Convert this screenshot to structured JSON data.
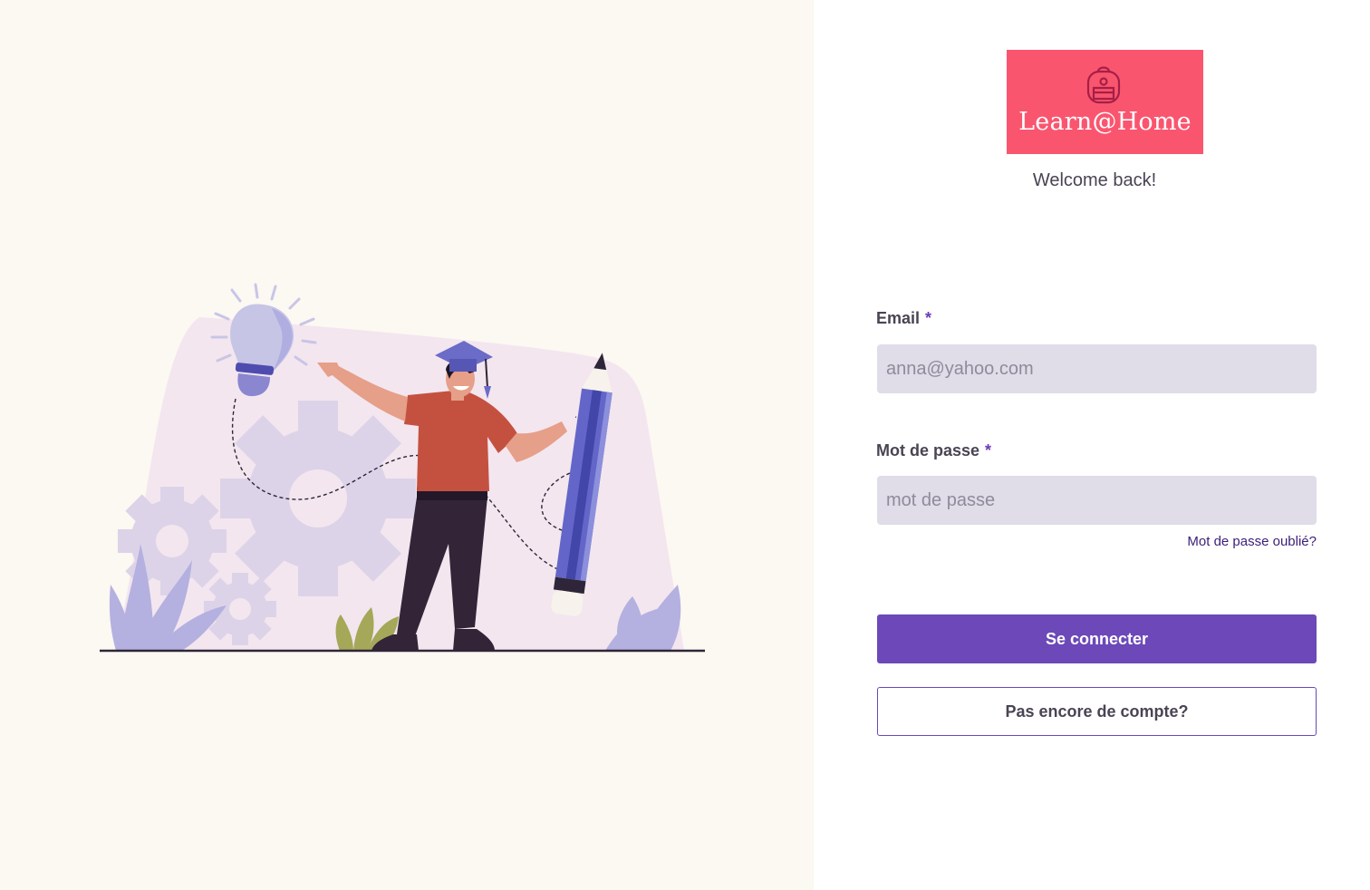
{
  "brand": {
    "name": "Learn@Home",
    "color": "#fa556f",
    "icon": "backpack-icon"
  },
  "welcome_text": "Welcome back!",
  "form": {
    "email": {
      "label": "Email",
      "required_mark": "*",
      "placeholder": "anna@yahoo.com",
      "value": ""
    },
    "password": {
      "label": "Mot de passe",
      "required_mark": "*",
      "placeholder": "mot de passe",
      "value": ""
    },
    "forgot_password_link": "Mot de passe oublié?",
    "submit_label": "Se connecter",
    "signup_label": "Pas encore de compte?"
  },
  "colors": {
    "accent": "#6c48b8",
    "left_background": "#fcf8f2",
    "input_background": "#e0dce8"
  },
  "illustration": {
    "subject": "student-with-pencil-illustration",
    "icons": [
      "lightbulb-icon",
      "gear-icon",
      "graduation-cap-icon",
      "pencil-icon",
      "plant-icon"
    ]
  }
}
